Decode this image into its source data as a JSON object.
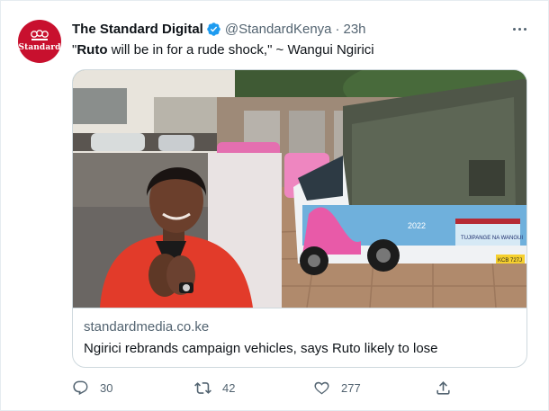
{
  "author": {
    "display_name": "The Standard Digital",
    "handle": "@StandardKenya",
    "separator": "·",
    "time": "23h",
    "avatar_text": "Standard"
  },
  "tweet": {
    "text_bold": "Ruto",
    "text_before": "\"",
    "text_after": " will be in for a rude shock,\" ~ Wangui Ngirici"
  },
  "card": {
    "domain": "standardmedia.co.ke",
    "title": "Ngirici rebrands campaign vehicles, says Ruto likely to lose",
    "photo_texts": {
      "plate": "KCB 727J",
      "year": "2022",
      "banner": "TUJIPANGE NA WANGUI"
    }
  },
  "actions": {
    "reply_count": "30",
    "retweet_count": "42",
    "like_count": "277"
  },
  "colors": {
    "brand": "#c8102e",
    "verified": "#1d9bf0",
    "secondary_text": "#536471",
    "border": "#cfd9de"
  },
  "icons": [
    "more-icon",
    "verified-badge-icon",
    "reply-icon",
    "retweet-icon",
    "like-icon",
    "share-icon"
  ]
}
